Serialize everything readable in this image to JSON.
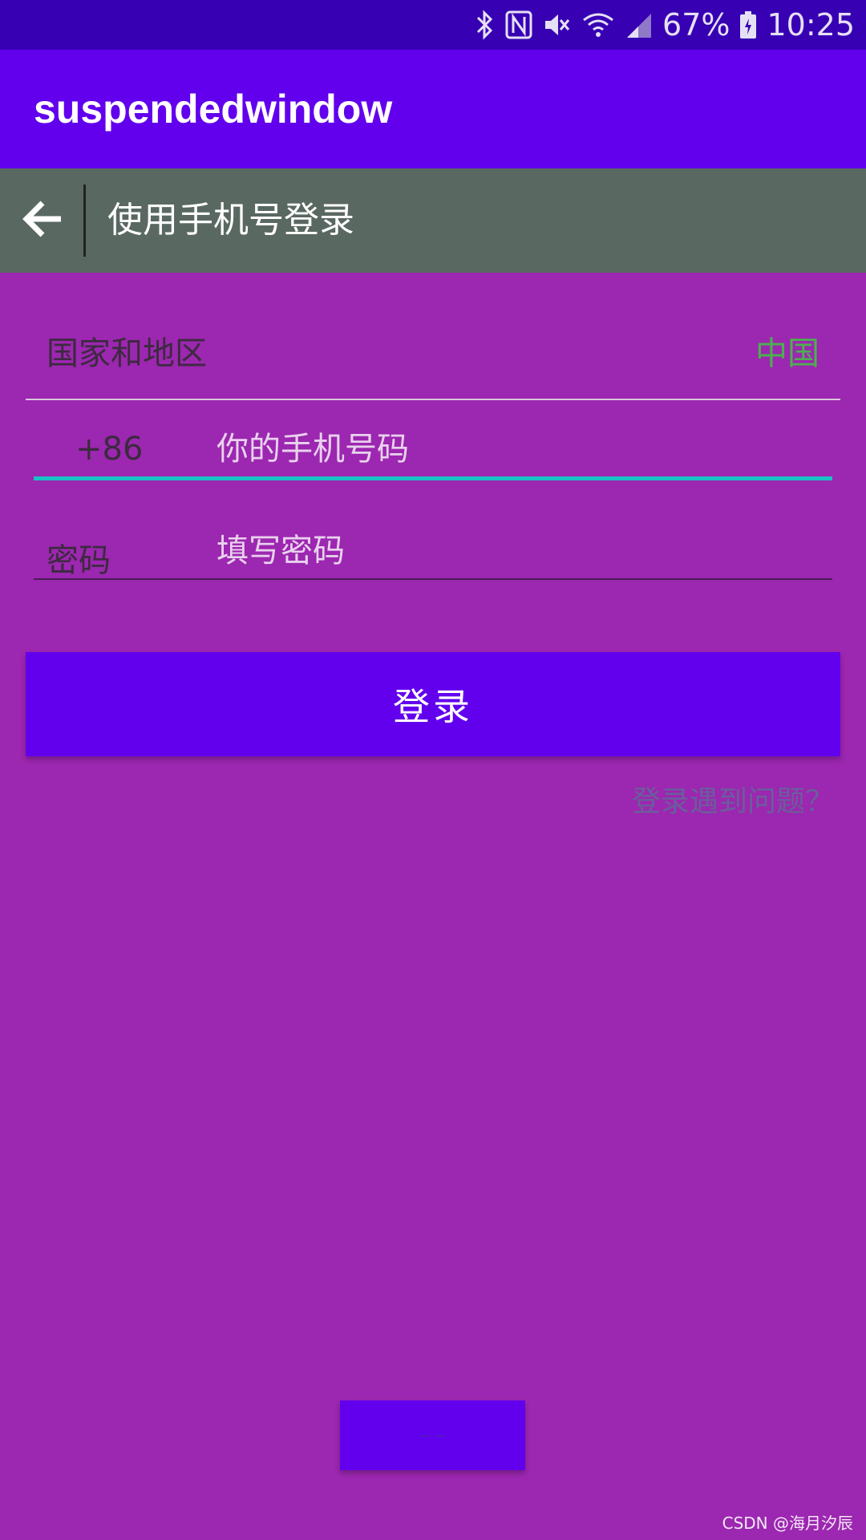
{
  "status_bar": {
    "battery": "67%",
    "time": "10:25",
    "icons": [
      "bluetooth-icon",
      "nfc-icon",
      "mute-icon",
      "wifi-icon",
      "signal-icon",
      "battery-icon"
    ]
  },
  "app_bar": {
    "title": "suspendedwindow"
  },
  "sub_bar": {
    "title": "使用手机号登录",
    "back_icon": "arrow-left-icon"
  },
  "form": {
    "region_label": "国家和地区",
    "region_value": "中国",
    "country_code": "+86",
    "phone_placeholder": "你的手机号码",
    "password_label": "密码",
    "password_placeholder": "填写密码"
  },
  "login_button": "登录",
  "help_link": "登录遇到问题？",
  "floating_button": "— —",
  "watermark": "CSDN @海月汐辰",
  "colors": {
    "status_bar": "#3700b3",
    "app_bar": "#6200ee",
    "sub_bar": "#5a6862",
    "background": "#9c27b0",
    "accent": "#18c4c4",
    "region_value": "#4caf50"
  }
}
